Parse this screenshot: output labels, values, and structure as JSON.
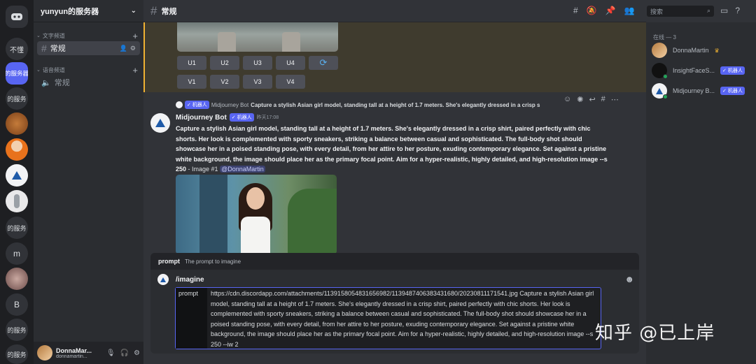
{
  "rail": {
    "items": [
      {
        "label": ""
      },
      {
        "label": "不懂"
      },
      {
        "label": "的服务器"
      },
      {
        "label": "的服务"
      },
      {
        "label": ""
      },
      {
        "label": ""
      },
      {
        "label": ""
      },
      {
        "label": ""
      },
      {
        "label": "的服务"
      },
      {
        "label": "m"
      },
      {
        "label": ""
      },
      {
        "label": "B"
      },
      {
        "label": "的服务"
      },
      {
        "label": "的服务"
      }
    ]
  },
  "sidebar": {
    "server_name": "yunyun的服务器",
    "text_category": "文字频道",
    "voice_category": "语音频道",
    "text_channel": "常规",
    "voice_channel": "常规"
  },
  "user": {
    "name": "DonnaMar...",
    "tag": "donnamartin..."
  },
  "header": {
    "channel": "常规",
    "search_placeholder": "搜索"
  },
  "message1": {
    "upscale_buttons": [
      "U1",
      "U2",
      "U3",
      "U4"
    ],
    "variation_buttons": [
      "V1",
      "V2",
      "V3",
      "V4"
    ],
    "reroll_icon": "⟳"
  },
  "message2": {
    "reply_badge": "✓ 机器人",
    "reply_author": "Midjourney Bot",
    "reply_snippet": "Capture a stylish Asian girl model, standing tall at a height of 1.7 meters. She's elegantly dressed in a crisp s",
    "author": "Midjourney Bot",
    "badge": "✓ 机器人",
    "timestamp": "昨天17:08",
    "prompt_bold": "Capture a stylish Asian girl model, standing tall at a height of 1.7 meters. She's elegantly dressed in a crisp shirt, paired perfectly with chic shorts. Her look is complemented with sporty sneakers, striking a balance between casual and sophisticated. The full-body shot should showcase her in a poised standing pose, with every detail, from her attire to her posture, exuding contemporary elegance. Set against a pristine white background, the image should place her as the primary focal point. Aim for a hyper-realistic, highly detailed, and high-resolution image --s 250",
    "suffix": " - Image #1 ",
    "mention": "@DonnaMartin"
  },
  "composer": {
    "option_name": "prompt",
    "option_desc": "The prompt to imagine",
    "command": "/imagine",
    "prompt_label": "prompt",
    "prompt_value": "https://cdn.discordapp.com/attachments/1139158054831656982/1139487406383431680/20230811171541.jpg  Capture a stylish Asian girl model, standing tall at a height of 1.7 meters. She's elegantly dressed in a crisp shirt, paired perfectly with chic shorts. Her look is complemented with sporty sneakers, striking a balance between casual and sophisticated. The full-body shot should showcase her in a poised standing pose, with every detail, from her attire to her posture, exuding contemporary elegance. Set against a pristine white background, the image should place her as the primary focal point. Aim for a hyper-realistic, highly detailed, and high-resolution image --s 250 --iw 2"
  },
  "members": {
    "header": "在线 — 3",
    "list": [
      {
        "name": "DonnaMartin",
        "badge": ""
      },
      {
        "name": "InsightFaceS...",
        "badge": "✓ 机器人"
      },
      {
        "name": "Midjourney B...",
        "badge": "✓ 机器人"
      }
    ]
  },
  "watermark": "知乎 @已上岸",
  "colors": {
    "accent": "#5865f2",
    "highlight_border": "#f0b232",
    "online": "#23a55a"
  }
}
